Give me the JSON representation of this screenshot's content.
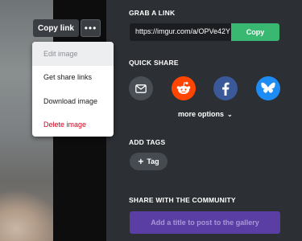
{
  "image_toolbar": {
    "copy_link_label": "Copy link",
    "more_label": "•••"
  },
  "context_menu": {
    "items": [
      {
        "label": "Edit image",
        "state": "disabled"
      },
      {
        "label": "Get share links",
        "state": "normal"
      },
      {
        "label": "Download image",
        "state": "normal"
      },
      {
        "label": "Delete image",
        "state": "danger"
      }
    ]
  },
  "grab_link": {
    "title": "GRAB A LINK",
    "url_value": "https://imgur.com/a/OPVe42Y",
    "copy_label": "Copy"
  },
  "quick_share": {
    "title": "QUICK SHARE",
    "icons": [
      "email-icon",
      "reddit-icon",
      "facebook-icon",
      "bluesky-icon"
    ],
    "more_options_label": "more options",
    "colors": {
      "email": "#4a4e55",
      "reddit": "#ff4500",
      "facebook": "#3b5998",
      "bluesky": "#1e8cf5"
    }
  },
  "add_tags": {
    "title": "ADD TAGS",
    "tag_button_label": "Tag"
  },
  "community": {
    "title": "SHARE WITH THE COMMUNITY",
    "post_button_label": "Add a title to post to the gallery"
  }
}
